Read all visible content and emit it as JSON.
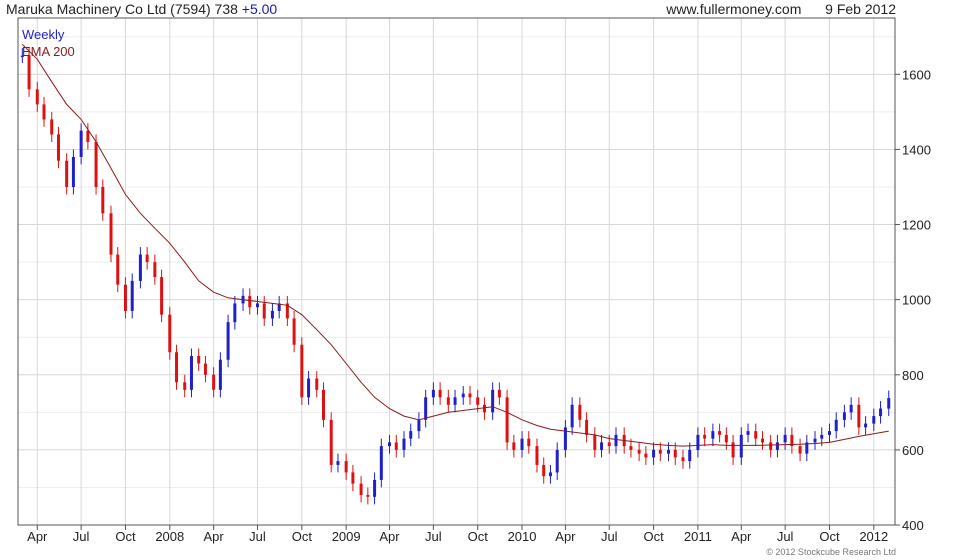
{
  "header": {
    "title": "Maruka Machinery Co Ltd (7594) 738",
    "change": "+5.00",
    "source": "www.fullermoney.com",
    "date": "9 Feb 2012"
  },
  "footer": {
    "copyright": "© 2012 Stockcube Research Ltd"
  },
  "colors": {
    "up": "#1f1fcc",
    "down": "#dd1111",
    "ema": "#8b1a1a",
    "grid": "#d8d8d8",
    "weekly_label": "#1f1fcc"
  },
  "chart_data": {
    "type": "candlestick",
    "title": "Maruka Machinery Co Ltd (7594) 738",
    "ylim": [
      400,
      1750
    ],
    "yticks": [
      400,
      600,
      800,
      1000,
      1200,
      1400,
      1600
    ],
    "x_tick_labels": [
      "Apr",
      "Jul",
      "Oct",
      "2008",
      "Apr",
      "Jul",
      "Oct",
      "2009",
      "Apr",
      "Jul",
      "Oct",
      "2010",
      "Apr",
      "Jul",
      "Oct",
      "2011",
      "Apr",
      "Jul",
      "Oct",
      "2012"
    ],
    "grid": true,
    "legend_position": "top-left",
    "series": [
      {
        "name": "Weekly",
        "kind": "close",
        "points": [
          [
            "2007-03-01",
            1650
          ],
          [
            "2007-03-15",
            1560
          ],
          [
            "2007-04-01",
            1520
          ],
          [
            "2007-04-15",
            1480
          ],
          [
            "2007-05-01",
            1440
          ],
          [
            "2007-05-15",
            1370
          ],
          [
            "2007-06-01",
            1300
          ],
          [
            "2007-06-15",
            1380
          ],
          [
            "2007-07-01",
            1450
          ],
          [
            "2007-07-15",
            1420
          ],
          [
            "2007-08-01",
            1300
          ],
          [
            "2007-08-15",
            1230
          ],
          [
            "2007-09-01",
            1120
          ],
          [
            "2007-09-15",
            1040
          ],
          [
            "2007-10-01",
            970
          ],
          [
            "2007-10-15",
            1050
          ],
          [
            "2007-11-01",
            1120
          ],
          [
            "2007-11-15",
            1100
          ],
          [
            "2007-12-01",
            1060
          ],
          [
            "2007-12-15",
            960
          ],
          [
            "2008-01-01",
            860
          ],
          [
            "2008-01-15",
            780
          ],
          [
            "2008-02-01",
            760
          ],
          [
            "2008-02-15",
            850
          ],
          [
            "2008-03-01",
            830
          ],
          [
            "2008-03-15",
            800
          ],
          [
            "2008-04-01",
            760
          ],
          [
            "2008-04-15",
            840
          ],
          [
            "2008-05-01",
            940
          ],
          [
            "2008-05-15",
            990
          ],
          [
            "2008-06-01",
            1010
          ],
          [
            "2008-06-15",
            980
          ],
          [
            "2008-07-01",
            990
          ],
          [
            "2008-07-15",
            950
          ],
          [
            "2008-08-01",
            970
          ],
          [
            "2008-08-15",
            990
          ],
          [
            "2008-09-01",
            950
          ],
          [
            "2008-09-15",
            880
          ],
          [
            "2008-10-01",
            740
          ],
          [
            "2008-10-15",
            790
          ],
          [
            "2008-11-01",
            760
          ],
          [
            "2008-11-15",
            680
          ],
          [
            "2008-12-01",
            560
          ],
          [
            "2008-12-15",
            570
          ],
          [
            "2009-01-01",
            540
          ],
          [
            "2009-01-15",
            510
          ],
          [
            "2009-02-01",
            480
          ],
          [
            "2009-02-15",
            475
          ],
          [
            "2009-03-01",
            520
          ],
          [
            "2009-03-15",
            610
          ],
          [
            "2009-04-01",
            620
          ],
          [
            "2009-04-15",
            600
          ],
          [
            "2009-05-01",
            630
          ],
          [
            "2009-05-15",
            650
          ],
          [
            "2009-06-01",
            680
          ],
          [
            "2009-06-15",
            740
          ],
          [
            "2009-07-01",
            760
          ],
          [
            "2009-07-15",
            740
          ],
          [
            "2009-08-01",
            720
          ],
          [
            "2009-08-15",
            740
          ],
          [
            "2009-09-01",
            750
          ],
          [
            "2009-09-15",
            740
          ],
          [
            "2009-10-01",
            720
          ],
          [
            "2009-10-15",
            700
          ],
          [
            "2009-11-01",
            760
          ],
          [
            "2009-11-15",
            740
          ],
          [
            "2009-12-01",
            620
          ],
          [
            "2009-12-15",
            600
          ],
          [
            "2010-01-01",
            630
          ],
          [
            "2010-01-15",
            610
          ],
          [
            "2010-02-01",
            560
          ],
          [
            "2010-02-15",
            530
          ],
          [
            "2010-03-01",
            540
          ],
          [
            "2010-03-15",
            600
          ],
          [
            "2010-04-01",
            660
          ],
          [
            "2010-04-15",
            720
          ],
          [
            "2010-05-01",
            680
          ],
          [
            "2010-05-15",
            640
          ],
          [
            "2010-06-01",
            600
          ],
          [
            "2010-06-15",
            620
          ],
          [
            "2010-07-01",
            610
          ],
          [
            "2010-07-15",
            640
          ],
          [
            "2010-08-01",
            610
          ],
          [
            "2010-08-15",
            600
          ],
          [
            "2010-09-01",
            590
          ],
          [
            "2010-09-15",
            580
          ],
          [
            "2010-10-01",
            600
          ],
          [
            "2010-10-15",
            590
          ],
          [
            "2010-11-01",
            600
          ],
          [
            "2010-11-15",
            580
          ],
          [
            "2010-12-01",
            570
          ],
          [
            "2010-12-15",
            600
          ],
          [
            "2011-01-01",
            640
          ],
          [
            "2011-01-15",
            630
          ],
          [
            "2011-02-01",
            650
          ],
          [
            "2011-02-15",
            640
          ],
          [
            "2011-03-01",
            620
          ],
          [
            "2011-03-15",
            580
          ],
          [
            "2011-04-01",
            640
          ],
          [
            "2011-04-15",
            650
          ],
          [
            "2011-05-01",
            630
          ],
          [
            "2011-05-15",
            620
          ],
          [
            "2011-06-01",
            600
          ],
          [
            "2011-06-15",
            620
          ],
          [
            "2011-07-01",
            640
          ],
          [
            "2011-07-15",
            610
          ],
          [
            "2011-08-01",
            590
          ],
          [
            "2011-08-15",
            620
          ],
          [
            "2011-09-01",
            630
          ],
          [
            "2011-09-15",
            640
          ],
          [
            "2011-10-01",
            650
          ],
          [
            "2011-10-15",
            680
          ],
          [
            "2011-11-01",
            700
          ],
          [
            "2011-11-15",
            720
          ],
          [
            "2011-12-01",
            660
          ],
          [
            "2011-12-15",
            670
          ],
          [
            "2012-01-01",
            690
          ],
          [
            "2012-01-15",
            710
          ],
          [
            "2012-02-01",
            738
          ]
        ]
      },
      {
        "name": "EMA 200",
        "kind": "line",
        "points": [
          [
            "2007-03-01",
            1680
          ],
          [
            "2007-04-01",
            1640
          ],
          [
            "2007-05-01",
            1580
          ],
          [
            "2007-06-01",
            1520
          ],
          [
            "2007-07-01",
            1480
          ],
          [
            "2007-08-01",
            1420
          ],
          [
            "2007-09-01",
            1350
          ],
          [
            "2007-10-01",
            1280
          ],
          [
            "2007-11-01",
            1230
          ],
          [
            "2007-12-01",
            1190
          ],
          [
            "2008-01-01",
            1150
          ],
          [
            "2008-02-01",
            1100
          ],
          [
            "2008-03-01",
            1050
          ],
          [
            "2008-04-01",
            1020
          ],
          [
            "2008-05-01",
            1005
          ],
          [
            "2008-06-01",
            1000
          ],
          [
            "2008-07-01",
            995
          ],
          [
            "2008-08-01",
            990
          ],
          [
            "2008-09-01",
            985
          ],
          [
            "2008-10-01",
            960
          ],
          [
            "2008-11-01",
            920
          ],
          [
            "2008-12-01",
            880
          ],
          [
            "2009-01-01",
            830
          ],
          [
            "2009-02-01",
            780
          ],
          [
            "2009-03-01",
            740
          ],
          [
            "2009-04-01",
            710
          ],
          [
            "2009-05-01",
            690
          ],
          [
            "2009-06-01",
            680
          ],
          [
            "2009-07-01",
            690
          ],
          [
            "2009-08-01",
            700
          ],
          [
            "2009-09-01",
            705
          ],
          [
            "2009-10-01",
            710
          ],
          [
            "2009-11-01",
            715
          ],
          [
            "2009-12-01",
            700
          ],
          [
            "2010-01-01",
            680
          ],
          [
            "2010-02-01",
            665
          ],
          [
            "2010-03-01",
            655
          ],
          [
            "2010-04-01",
            650
          ],
          [
            "2010-05-01",
            645
          ],
          [
            "2010-06-01",
            640
          ],
          [
            "2010-07-01",
            630
          ],
          [
            "2010-08-01",
            625
          ],
          [
            "2010-09-01",
            620
          ],
          [
            "2010-10-01",
            615
          ],
          [
            "2010-11-01",
            612
          ],
          [
            "2010-12-01",
            610
          ],
          [
            "2011-01-01",
            612
          ],
          [
            "2011-02-01",
            614
          ],
          [
            "2011-03-01",
            612
          ],
          [
            "2011-04-01",
            612
          ],
          [
            "2011-05-01",
            612
          ],
          [
            "2011-06-01",
            613
          ],
          [
            "2011-07-01",
            614
          ],
          [
            "2011-08-01",
            615
          ],
          [
            "2011-09-01",
            617
          ],
          [
            "2011-10-01",
            620
          ],
          [
            "2011-11-01",
            628
          ],
          [
            "2011-12-01",
            636
          ],
          [
            "2012-01-01",
            643
          ],
          [
            "2012-02-01",
            650
          ]
        ]
      }
    ]
  }
}
